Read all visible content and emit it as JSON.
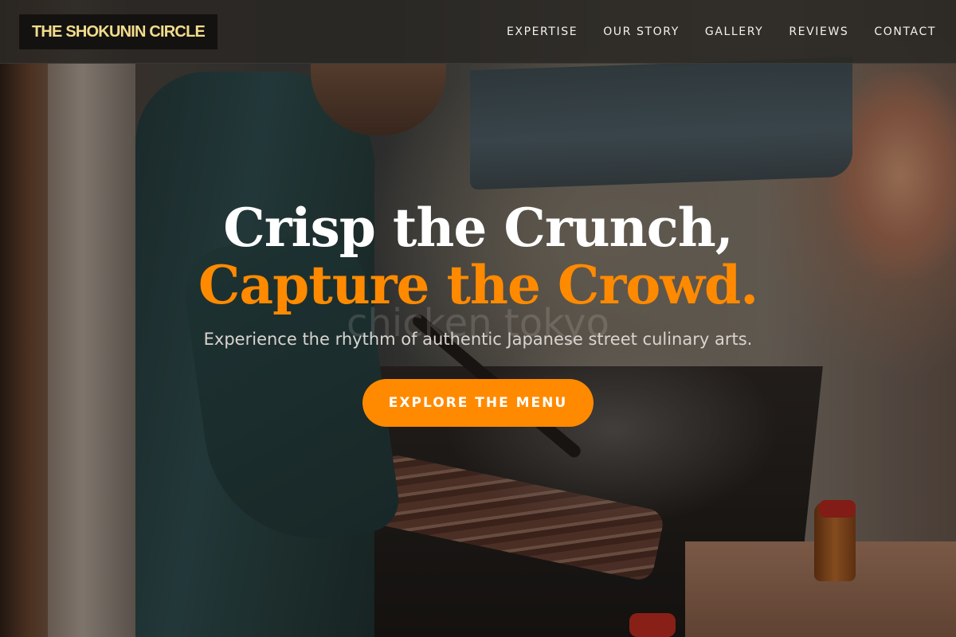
{
  "header": {
    "logo": "THE SHOKUNIN CIRCLE",
    "nav": [
      {
        "label": "EXPERTISE"
      },
      {
        "label": "OUR STORY"
      },
      {
        "label": "GALLERY"
      },
      {
        "label": "REVIEWS"
      },
      {
        "label": "CONTACT"
      }
    ]
  },
  "hero": {
    "headline_line1": "Crisp the Crunch,",
    "headline_line2": "Capture the Crowd.",
    "watermark": "chicken tokyo",
    "tagline": "Experience the rhythm of authentic Japanese street culinary arts.",
    "cta_label": "EXPLORE THE MENU"
  },
  "colors": {
    "accent": "#ff8a00",
    "logo_text": "#f2dc8c",
    "header_bg": "#2a2824"
  }
}
